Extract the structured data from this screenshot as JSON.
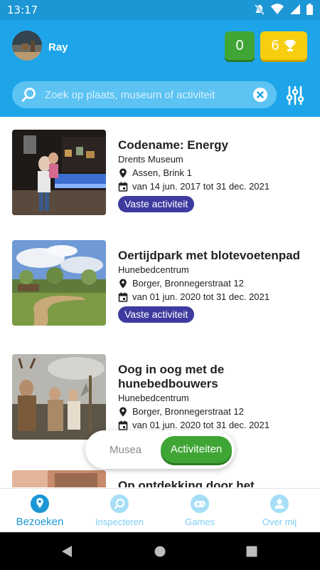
{
  "status_bar": {
    "time": "13:17"
  },
  "header": {
    "username": "Ray",
    "green_badge": "0",
    "gold_badge": "6"
  },
  "search": {
    "placeholder": "Zoek op plaats, museum of activiteit",
    "value": ""
  },
  "items": [
    {
      "title_lines": [
        "Codename: Energy"
      ],
      "venue": "Drents Museum",
      "address": "Assen, Brink 1",
      "dates": "van 14 jun. 2017 tot 31 dec. 2021",
      "tag": "Vaste activiteit"
    },
    {
      "title_lines": [
        "Oertijdpark met blotevoetenpad"
      ],
      "venue": "Hunebedcentrum",
      "address": "Borger, Bronnegerstraat 12",
      "dates": "van 01 jun. 2020 tot 31 dec. 2021",
      "tag": "Vaste activiteit"
    },
    {
      "title_lines": [
        "Oog in oog met de",
        "hunebedbouwers"
      ],
      "venue": "Hunebedcentrum",
      "address": "Borger, Bronnegerstraat 12",
      "dates": "van 01 jun. 2020 tot 31 dec. 2021"
    },
    {
      "title_lines": [
        "Op ontdekking door het"
      ]
    }
  ],
  "toggle": {
    "musea": "Musea",
    "activiteiten": "Activiteiten",
    "selected": "Activiteiten"
  },
  "bottom_nav": [
    {
      "label": "Bezoeken",
      "icon": "map-pin-icon",
      "active": true
    },
    {
      "label": "Inspecteren",
      "icon": "magnifier-icon",
      "active": false
    },
    {
      "label": "Games",
      "icon": "gamepad-icon",
      "active": false
    },
    {
      "label": "Over mij",
      "icon": "user-icon",
      "active": false
    }
  ],
  "colors": {
    "primary": "#1ea5e9",
    "tag": "#3d3aa0",
    "green": "#3fa535",
    "gold": "#f7cf0f"
  }
}
